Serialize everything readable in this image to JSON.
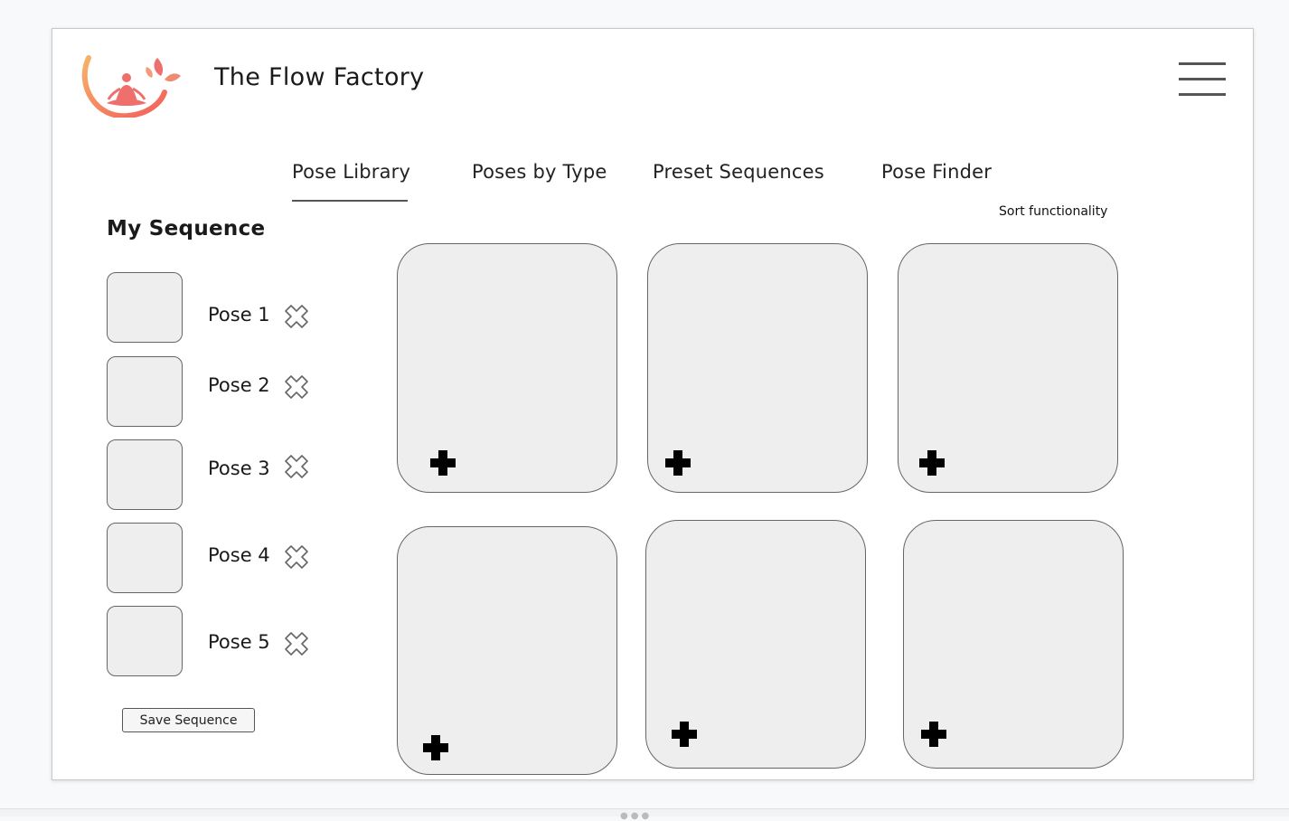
{
  "app": {
    "title": "The Flow Factory"
  },
  "header": {
    "logo_icon": "meditation-lotus-logo",
    "menu_icon": "hamburger-menu-icon"
  },
  "tabs": [
    {
      "label": "Pose Library",
      "active": true
    },
    {
      "label": "Poses by Type",
      "active": false
    },
    {
      "label": "Preset Sequences",
      "active": false
    },
    {
      "label": "Pose Finder",
      "active": false
    }
  ],
  "sort": {
    "label": "Sort functionality"
  },
  "sequence": {
    "title": "My Sequence",
    "items": [
      {
        "label": "Pose 1"
      },
      {
        "label": "Pose 2"
      },
      {
        "label": "Pose 3"
      },
      {
        "label": "Pose 4"
      },
      {
        "label": "Pose 5"
      }
    ],
    "save_label": "Save Sequence"
  },
  "library": {
    "card_count": 6,
    "add_icon": "plus-icon"
  },
  "colors": {
    "logo_gradient_start": "#f7b267",
    "logo_gradient_end": "#f25f5c",
    "card_fill": "#eeeeee",
    "card_border": "#666666"
  }
}
